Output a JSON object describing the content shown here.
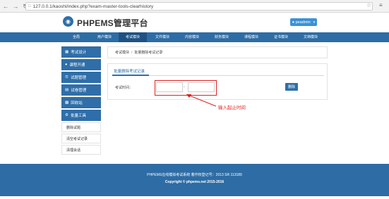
{
  "browser": {
    "url": "127.0.0.1/kaoshi/index.php?exam-master-tools-clearhistory",
    "back_icon": "arrow-left",
    "forward_icon": "arrow-right",
    "reload_icon": "reload"
  },
  "header": {
    "site_title": "PHPEMS管理平台",
    "user_label": "peadmin"
  },
  "nav": {
    "items": [
      "全局",
      "用户模块",
      "考试模块",
      "文件模块",
      "内容模块",
      "财务模块",
      "课程模块",
      "证书模块",
      "文档模块"
    ],
    "active_index": 2
  },
  "sidebar": {
    "items": [
      {
        "label": "考试设计",
        "icon": "grid"
      },
      {
        "label": "课程开通",
        "icon": "user"
      },
      {
        "label": "试题管理",
        "icon": "list"
      },
      {
        "label": "试卷管理",
        "icon": "doc"
      },
      {
        "label": "回收站",
        "icon": "trash"
      },
      {
        "label": "批量工具",
        "icon": "wrench"
      }
    ],
    "sub_items": [
      "删除试题",
      "清空考试记录",
      "清理会话"
    ]
  },
  "breadcrumb": {
    "items": [
      "考试模块",
      "批量删除考试记录"
    ],
    "separator": "/"
  },
  "panel": {
    "tab_label": "批量删除考试记录",
    "field_label": "考试时间：",
    "dash": "-",
    "delete_button": "删除"
  },
  "annotation": {
    "text": "输入起止时间",
    "color": "#e02020"
  },
  "footer": {
    "line1": "PHPEMS在线模拟考试系统 着作权登记号：2013 SR 113189",
    "line2": "Copyright © phpems.net 2015-2016"
  },
  "colors": {
    "primary": "#2e6ca5",
    "accent": "#3a92d6",
    "highlight": "#e02020"
  }
}
